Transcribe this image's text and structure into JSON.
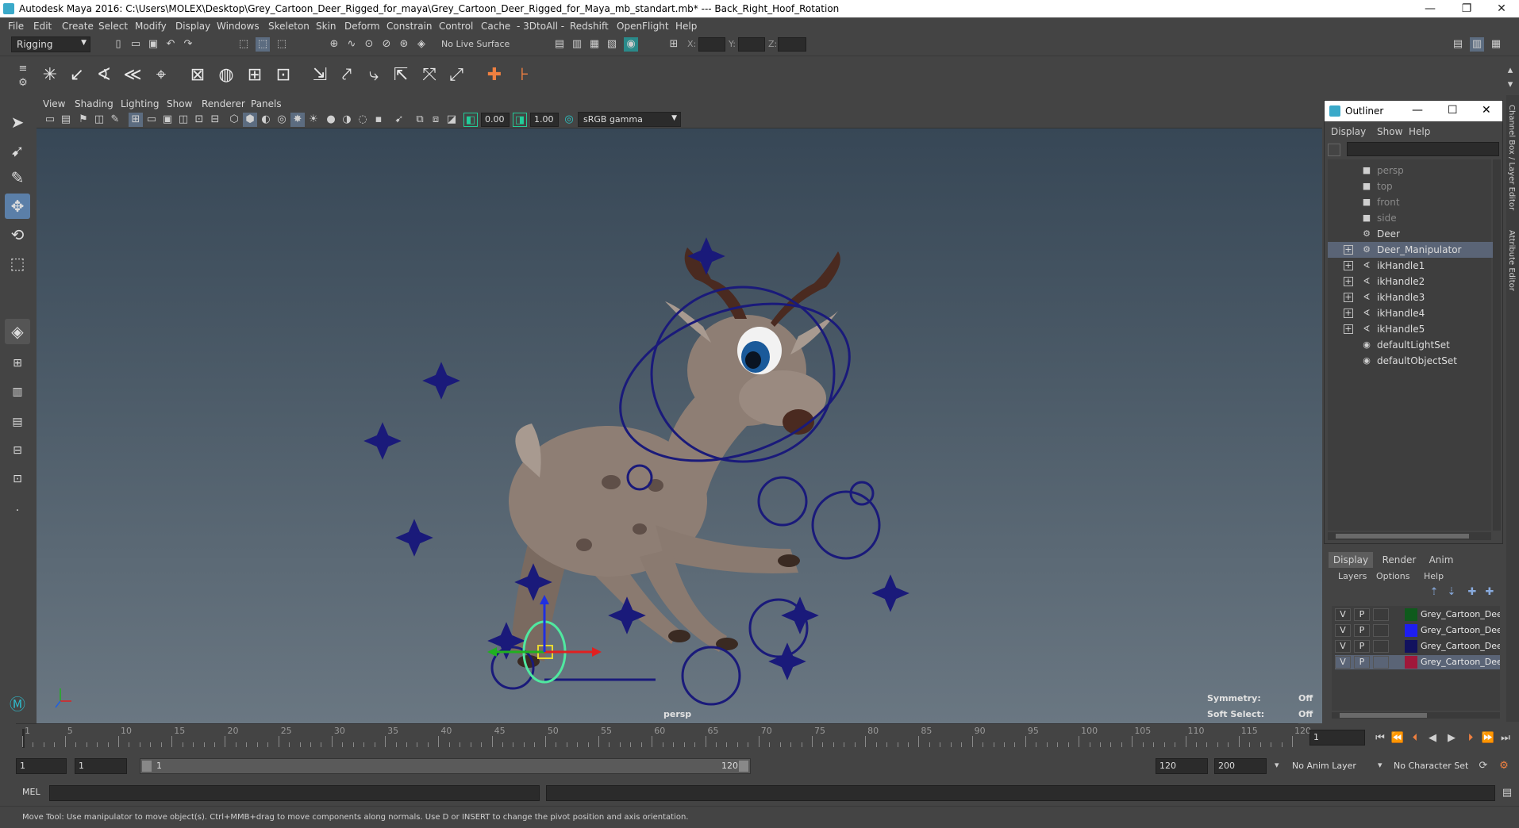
{
  "window": {
    "title": "Autodesk Maya 2016: C:\\Users\\MOLEX\\Desktop\\Grey_Cartoon_Deer_Rigged_for_maya\\Grey_Cartoon_Deer_Rigged_for_Maya_mb_standart.mb*   ---   Back_Right_Hoof_Rotation",
    "minimize": "—",
    "restore": "❐",
    "close": "✕"
  },
  "menubar": [
    "File",
    "Edit",
    "Create",
    "Select",
    "Modify",
    "Display",
    "Windows",
    "Skeleton",
    "Skin",
    "Deform",
    "Constrain",
    "Control",
    "Cache",
    "- 3DtoAll -",
    "Redshift",
    "OpenFlight",
    "Help"
  ],
  "statusline": {
    "menuset": "Rigging",
    "live_surface": "No Live Surface",
    "x_label": "X:",
    "y_label": "Y:",
    "z_label": "Z:"
  },
  "viewport": {
    "menu": [
      "View",
      "Shading",
      "Lighting",
      "Show",
      "Renderer",
      "Panels"
    ],
    "exposure": "0.00",
    "gamma": "1.00",
    "colorspace": "sRGB gamma",
    "camera_label": "persp",
    "symmetry_label": "Symmetry:",
    "symmetry_value": "Off",
    "soft_select_label": "Soft Select:",
    "soft_select_value": "Off"
  },
  "outliner": {
    "title": "Outliner",
    "menu": [
      "Display",
      "Show",
      "Help"
    ],
    "items": [
      {
        "label": "persp",
        "icon": "camera-icon",
        "dim": true,
        "expandable": false,
        "selected": false
      },
      {
        "label": "top",
        "icon": "camera-icon",
        "dim": true,
        "expandable": false,
        "selected": false
      },
      {
        "label": "front",
        "icon": "camera-icon",
        "dim": true,
        "expandable": false,
        "selected": false
      },
      {
        "label": "side",
        "icon": "camera-icon",
        "dim": true,
        "expandable": false,
        "selected": false
      },
      {
        "label": "Deer",
        "icon": "group-icon",
        "dim": false,
        "expandable": false,
        "selected": false
      },
      {
        "label": "Deer_Manipulator",
        "icon": "group-icon",
        "dim": false,
        "expandable": true,
        "selected": true
      },
      {
        "label": "ikHandle1",
        "icon": "ik-handle-icon",
        "dim": false,
        "expandable": true,
        "selected": false
      },
      {
        "label": "ikHandle2",
        "icon": "ik-handle-icon",
        "dim": false,
        "expandable": true,
        "selected": false
      },
      {
        "label": "ikHandle3",
        "icon": "ik-handle-icon",
        "dim": false,
        "expandable": true,
        "selected": false
      },
      {
        "label": "ikHandle4",
        "icon": "ik-handle-icon",
        "dim": false,
        "expandable": true,
        "selected": false
      },
      {
        "label": "ikHandle5",
        "icon": "ik-handle-icon",
        "dim": false,
        "expandable": true,
        "selected": false
      },
      {
        "label": "defaultLightSet",
        "icon": "set-icon",
        "dim": false,
        "expandable": false,
        "selected": false
      },
      {
        "label": "defaultObjectSet",
        "icon": "set-icon",
        "dim": false,
        "expandable": false,
        "selected": false
      }
    ]
  },
  "layer_editor": {
    "tabs": [
      "Display",
      "Render",
      "Anim"
    ],
    "menu": [
      "Layers",
      "Options",
      "Help"
    ],
    "layers": [
      {
        "v": "V",
        "p": "P",
        "color": "#0f5a1c",
        "name": "Grey_Cartoon_Deer_Rig",
        "selected": false
      },
      {
        "v": "V",
        "p": "P",
        "color": "#1e1ef0",
        "name": "Grey_Cartoon_Deer_Rig",
        "selected": false
      },
      {
        "v": "V",
        "p": "P",
        "color": "#12125e",
        "name": "Grey_Cartoon_Deer_Rig",
        "selected": false
      },
      {
        "v": "V",
        "p": "P",
        "color": "#a0173a",
        "name": "Grey_Cartoon_Deer_Rig",
        "selected": true
      }
    ]
  },
  "side_tabs": [
    "Channel Box / Layer Editor",
    "Attribute Editor"
  ],
  "timeline": {
    "ticks": [
      "1",
      "5",
      "10",
      "15",
      "20",
      "25",
      "30",
      "35",
      "40",
      "45",
      "50",
      "55",
      "60",
      "65",
      "70",
      "75",
      "80",
      "85",
      "90",
      "95",
      "100",
      "105",
      "110",
      "115",
      "120"
    ],
    "current_frame": "1",
    "range_start": "1",
    "range_inner_start": "1",
    "range_slider_start": "1",
    "range_slider_end": "120",
    "range_inner_end": "120",
    "range_end": "200",
    "anim_layer": "No Anim Layer",
    "character_set": "No Character Set"
  },
  "cmdline": {
    "label": "MEL"
  },
  "helpline": {
    "text": "Move Tool: Use manipulator to move object(s). Ctrl+MMB+drag to move components along normals. Use D or INSERT to change the pivot position and axis orientation."
  }
}
